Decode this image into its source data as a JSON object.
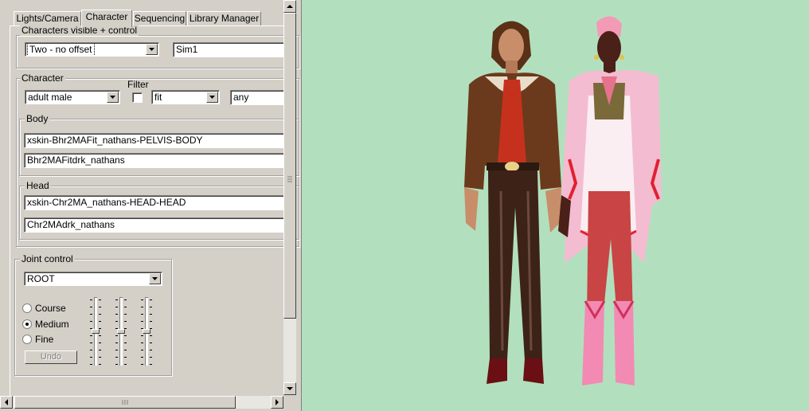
{
  "tabs": [
    {
      "label": "Lights/Camera",
      "active": false
    },
    {
      "label": "Character",
      "active": true
    },
    {
      "label": "Sequencing",
      "active": false
    },
    {
      "label": "Library Manager",
      "active": false
    }
  ],
  "visibility_group": {
    "legend": "Characters visible + control",
    "mode_value": "Two - no offset",
    "sim_name": "Sim1"
  },
  "character_group": {
    "legend": "Character",
    "filter_label": "Filter",
    "type_value": "adult male",
    "filter_value": "fit",
    "any_value": "any",
    "body": {
      "legend": "Body",
      "skin": "xskin-Bhr2MAFit_nathans-PELVIS-BODY",
      "texture": "Bhr2MAFitdrk_nathans"
    },
    "head": {
      "legend": "Head",
      "skin": "xskin-Chr2MA_nathans-HEAD-HEAD",
      "texture": "Chr2MAdrk_nathans"
    }
  },
  "joint_group": {
    "legend": "Joint control",
    "joint_value": "ROOT",
    "options": [
      {
        "label": "Course",
        "selected": false
      },
      {
        "label": "Medium",
        "selected": true
      },
      {
        "label": "Fine",
        "selected": false
      }
    ],
    "undo_label": "Undo"
  },
  "colors": {
    "viewport_bg": "#b2e0be",
    "panel_bg": "#d4d0c8"
  }
}
